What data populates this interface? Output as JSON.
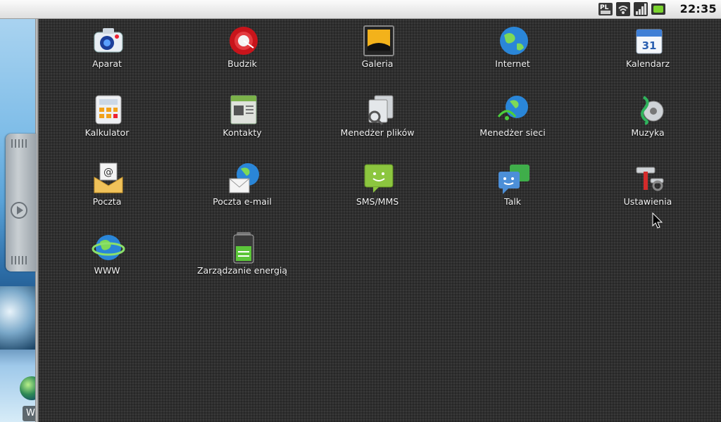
{
  "status_bar": {
    "time": "22:35",
    "icons": [
      "keyboard-layout-pl-icon",
      "wifi-icon",
      "signal-icon",
      "battery-icon"
    ]
  },
  "wallpaper": {
    "partial_label": "W"
  },
  "apps": [
    {
      "label": "Aparat",
      "icon": "camera-icon"
    },
    {
      "label": "Budzik",
      "icon": "alarm-clock-icon"
    },
    {
      "label": "Galeria",
      "icon": "gallery-icon"
    },
    {
      "label": "Internet",
      "icon": "globe-icon"
    },
    {
      "label": "Kalendarz",
      "icon": "calendar-icon",
      "day": "31"
    },
    {
      "label": "Kalkulator",
      "icon": "calculator-icon"
    },
    {
      "label": "Kontakty",
      "icon": "contacts-icon"
    },
    {
      "label": "Menedżer plików",
      "icon": "file-manager-icon"
    },
    {
      "label": "Menedżer sieci",
      "icon": "network-manager-icon"
    },
    {
      "label": "Muzyka",
      "icon": "music-icon"
    },
    {
      "label": "Poczta",
      "icon": "mail-icon"
    },
    {
      "label": "Poczta e-mail",
      "icon": "email-icon"
    },
    {
      "label": "SMS/MMS",
      "icon": "sms-icon"
    },
    {
      "label": "Talk",
      "icon": "talk-icon"
    },
    {
      "label": "Ustawienia",
      "icon": "settings-icon"
    },
    {
      "label": "WWW",
      "icon": "www-icon"
    },
    {
      "label": "Zarządzanie energią",
      "icon": "power-management-icon"
    }
  ]
}
